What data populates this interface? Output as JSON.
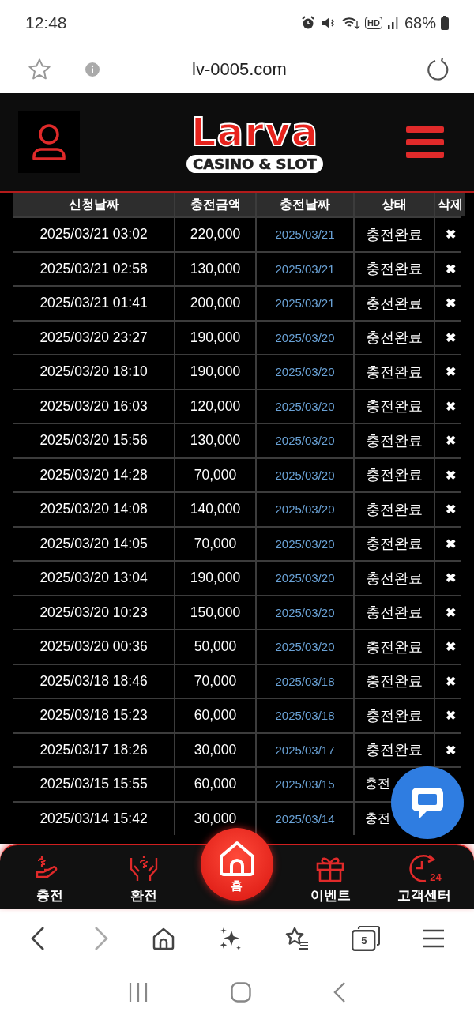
{
  "status_bar": {
    "time": "12:48",
    "network": "HD",
    "battery": "68%"
  },
  "browser": {
    "url": "lv-0005.com",
    "tab_count": "5"
  },
  "site_header": {
    "logo_title": "Larva",
    "logo_subtitle": "CASINO & SLOT"
  },
  "table": {
    "columns": [
      "신청날짜",
      "충전금액",
      "충전날짜",
      "상태",
      "삭제"
    ],
    "rows": [
      {
        "requested": "2025/03/21 03:02",
        "amount": "220,000",
        "charged": "2025/03/21",
        "status": "충전완료",
        "delete": "✖"
      },
      {
        "requested": "2025/03/21 02:58",
        "amount": "130,000",
        "charged": "2025/03/21",
        "status": "충전완료",
        "delete": "✖"
      },
      {
        "requested": "2025/03/21 01:41",
        "amount": "200,000",
        "charged": "2025/03/21",
        "status": "충전완료",
        "delete": "✖"
      },
      {
        "requested": "2025/03/20 23:27",
        "amount": "190,000",
        "charged": "2025/03/20",
        "status": "충전완료",
        "delete": "✖"
      },
      {
        "requested": "2025/03/20 18:10",
        "amount": "190,000",
        "charged": "2025/03/20",
        "status": "충전완료",
        "delete": "✖"
      },
      {
        "requested": "2025/03/20 16:03",
        "amount": "120,000",
        "charged": "2025/03/20",
        "status": "충전완료",
        "delete": "✖"
      },
      {
        "requested": "2025/03/20 15:56",
        "amount": "130,000",
        "charged": "2025/03/20",
        "status": "충전완료",
        "delete": "✖"
      },
      {
        "requested": "2025/03/20 14:28",
        "amount": "70,000",
        "charged": "2025/03/20",
        "status": "충전완료",
        "delete": "✖"
      },
      {
        "requested": "2025/03/20 14:08",
        "amount": "140,000",
        "charged": "2025/03/20",
        "status": "충전완료",
        "delete": "✖"
      },
      {
        "requested": "2025/03/20 14:05",
        "amount": "70,000",
        "charged": "2025/03/20",
        "status": "충전완료",
        "delete": "✖"
      },
      {
        "requested": "2025/03/20 13:04",
        "amount": "190,000",
        "charged": "2025/03/20",
        "status": "충전완료",
        "delete": "✖"
      },
      {
        "requested": "2025/03/20 10:23",
        "amount": "150,000",
        "charged": "2025/03/20",
        "status": "충전완료",
        "delete": "✖"
      },
      {
        "requested": "2025/03/20 00:36",
        "amount": "50,000",
        "charged": "2025/03/20",
        "status": "충전완료",
        "delete": "✖"
      },
      {
        "requested": "2025/03/18 18:46",
        "amount": "70,000",
        "charged": "2025/03/18",
        "status": "충전완료",
        "delete": "✖"
      },
      {
        "requested": "2025/03/18 15:23",
        "amount": "60,000",
        "charged": "2025/03/18",
        "status": "충전완료",
        "delete": "✖"
      },
      {
        "requested": "2025/03/17 18:26",
        "amount": "30,000",
        "charged": "2025/03/17",
        "status": "충전완료",
        "delete": "✖"
      },
      {
        "requested": "2025/03/15 15:55",
        "amount": "60,000",
        "charged": "2025/03/15",
        "status": "충전"
      },
      {
        "requested": "2025/03/14 15:42",
        "amount": "30,000",
        "charged": "2025/03/14",
        "status": "충전"
      }
    ]
  },
  "bottom_nav": [
    {
      "kind": "deposit",
      "label": "충전",
      "selected": false
    },
    {
      "kind": "exchange",
      "label": "환전",
      "selected": false
    },
    {
      "kind": "home",
      "label": "홈",
      "selected": true
    },
    {
      "kind": "event",
      "label": "이벤트",
      "selected": false
    },
    {
      "kind": "support",
      "label": "고객센터",
      "selected": false,
      "icon_text": "24"
    }
  ]
}
